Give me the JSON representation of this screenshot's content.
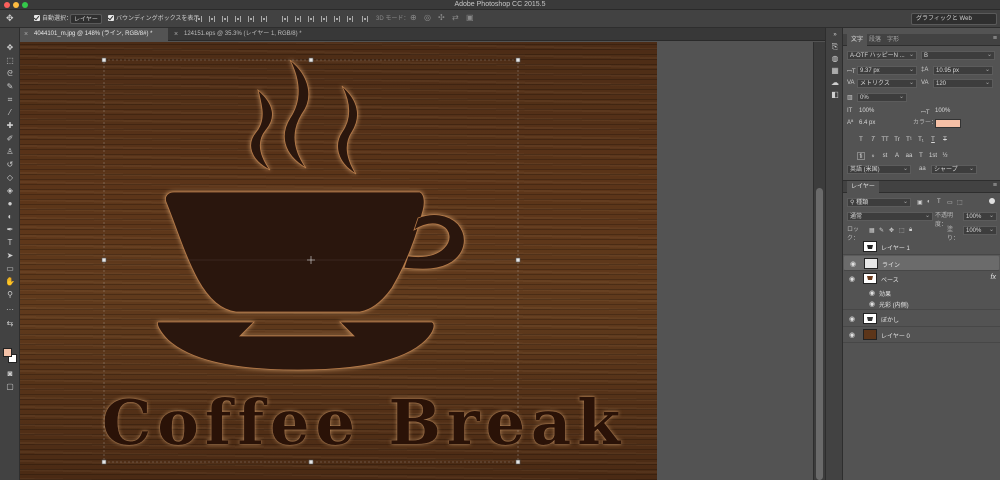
{
  "app": {
    "title": "Adobe Photoshop CC 2015.5"
  },
  "options_bar": {
    "auto_select_label": "自動選択：",
    "auto_select_target": "レイヤー",
    "bounding_box_label": "バウンディングボックスを表示",
    "mode_3d_label": "3D モード：",
    "workspace": "グラフィックと Web"
  },
  "tabs": [
    {
      "label": "4044101_m.jpg @ 148% (ライン, RGB/8#) *",
      "active": true
    },
    {
      "label": "124151.eps @ 35.3% (レイヤー 1, RGB/8) *",
      "active": false
    }
  ],
  "canvas": {
    "headline": "Coffee Break",
    "colors": {
      "wood": "#5c3519",
      "cut": "#2a1207",
      "glow": "#c89060"
    }
  },
  "character_panel": {
    "tabs": [
      "文字",
      "段落",
      "字形"
    ],
    "font_family": "A-OTF ハッピーN ...",
    "font_style": "B",
    "font_size": "9.37 px",
    "leading": "10.95 px",
    "kerning": "メトリクス",
    "tracking": "120",
    "tsume": "0%",
    "vertical_scale": "100%",
    "horizontal_scale": "100%",
    "baseline_shift": "6.4 px",
    "color_label": "カラー：",
    "text_color": "#f6c0a6",
    "type_buttons": [
      "T",
      "T",
      "TT",
      "Tr",
      "T¹",
      "T₁",
      "T",
      "T"
    ],
    "opentype_buttons": [
      "fi",
      "ℴ",
      "st",
      "A",
      "aa",
      "T",
      "1st",
      "½"
    ],
    "language": "英語 (米国)",
    "antialias_icon": "aa",
    "antialias": "シャープ"
  },
  "layers_panel": {
    "tab": "レイヤー",
    "filter": "種類",
    "blend_mode": "通常",
    "opacity_label": "不透明度：",
    "opacity": "100%",
    "lock_label": "ロック：",
    "fill_label": "塗り：",
    "fill": "100%",
    "layers": [
      {
        "name": "レイヤー 1",
        "visible": false,
        "selected": false
      },
      {
        "name": "ライン",
        "visible": true,
        "selected": true
      },
      {
        "name": "ベース",
        "visible": true,
        "selected": false,
        "fx": "fx"
      },
      {
        "name": "ぼかし",
        "visible": true,
        "selected": false
      },
      {
        "name": "レイヤー 0",
        "visible": true,
        "selected": false
      }
    ],
    "effects_label": "効果",
    "effect_item": "光彩 (内側)"
  }
}
